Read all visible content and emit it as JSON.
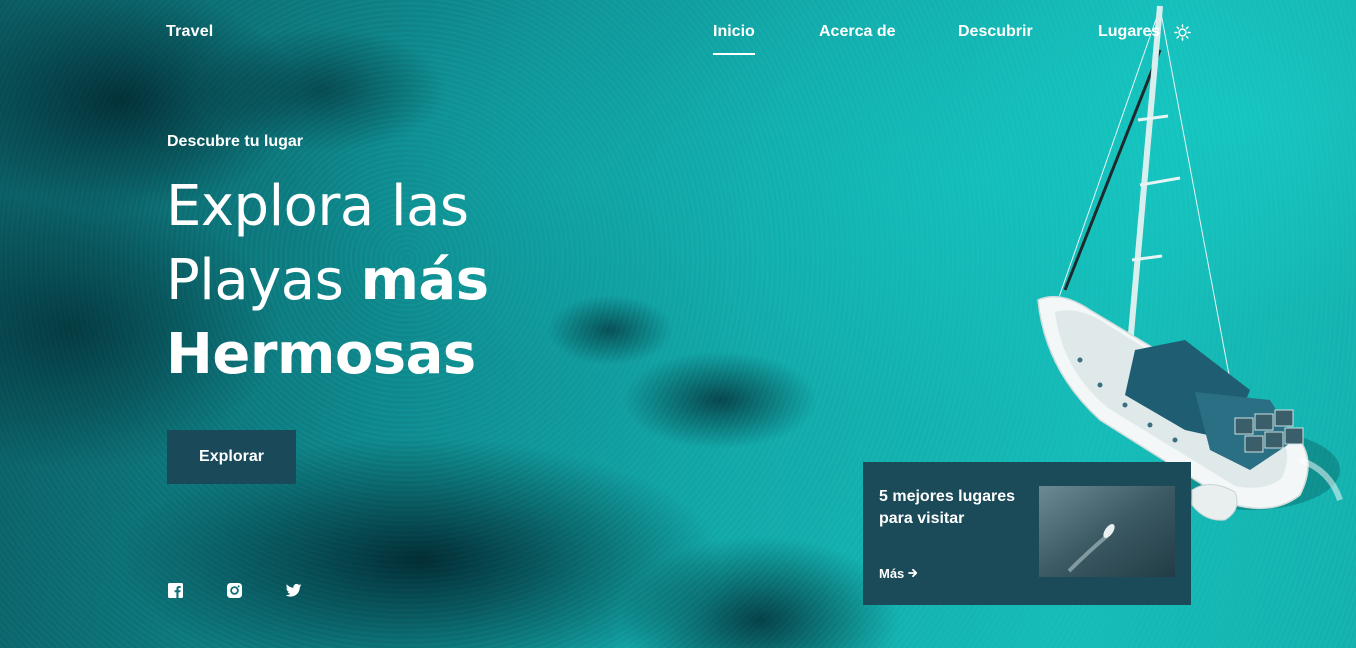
{
  "header": {
    "logo": "Travel",
    "nav": [
      {
        "label": "Inicio",
        "active": true
      },
      {
        "label": "Acerca de",
        "active": false
      },
      {
        "label": "Descubrir",
        "active": false
      },
      {
        "label": "Lugares",
        "active": false
      }
    ],
    "theme_toggle_icon": "sun-icon"
  },
  "hero": {
    "subtitle": "Descubre tu lugar",
    "title_line1": "Explora las",
    "title_line2_regular": "Playas ",
    "title_line2_bold": "más",
    "title_line3": "Hermosas",
    "button_label": "Explorar"
  },
  "social": [
    {
      "icon": "facebook-icon"
    },
    {
      "icon": "instagram-icon"
    },
    {
      "icon": "twitter-icon"
    }
  ],
  "card": {
    "title": "5 mejores lugares para visitar",
    "more_label": "Más",
    "more_icon": "arrow-right-icon"
  },
  "colors": {
    "button_bg": "#1a4a5a",
    "card_bg": "#1b4a59",
    "text": "#ffffff"
  }
}
